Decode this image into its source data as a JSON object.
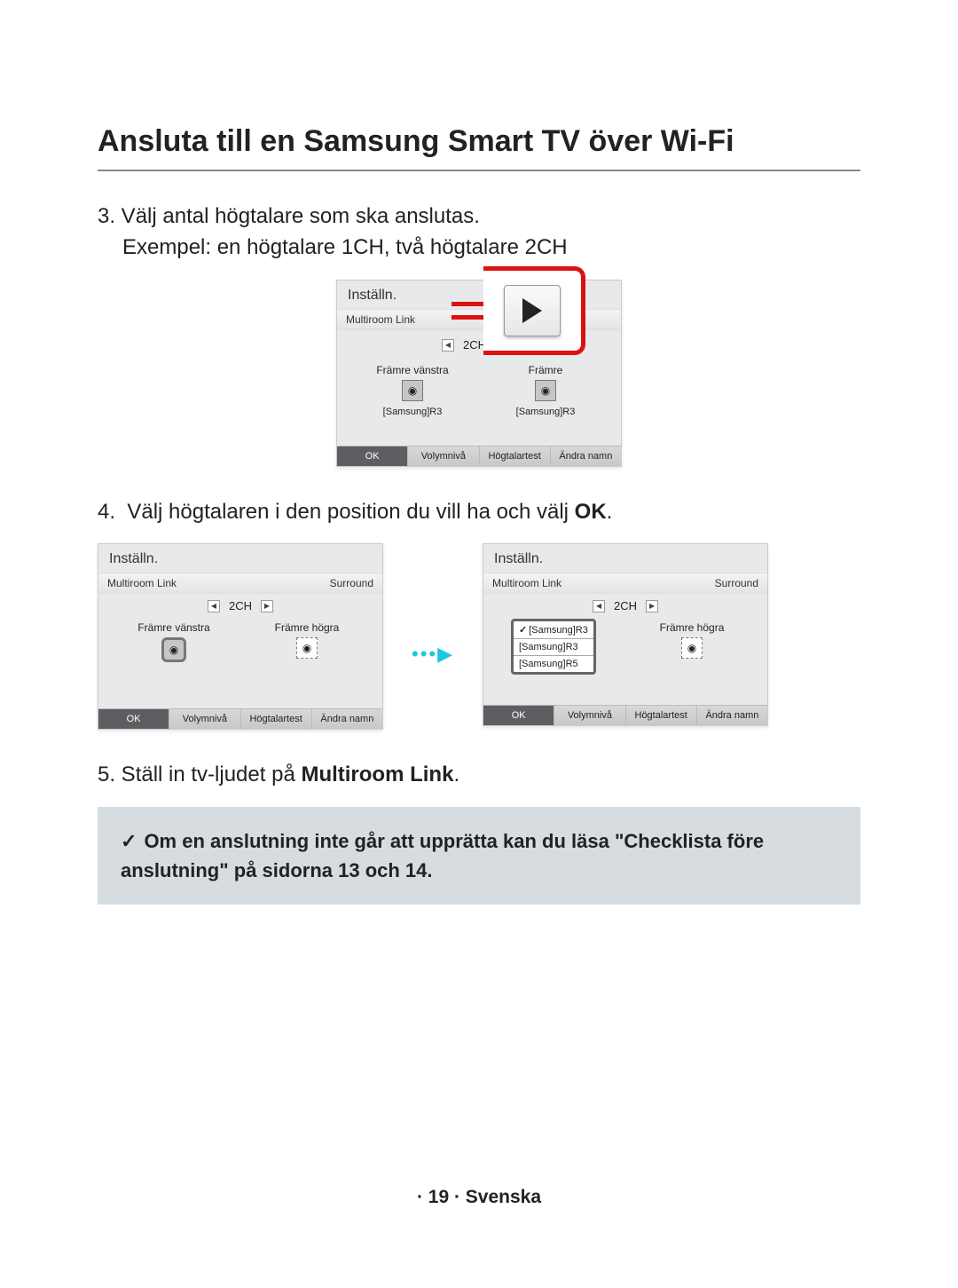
{
  "title": "Ansluta till en Samsung Smart TV över Wi-Fi",
  "step3": {
    "text": "3. Välj antal högtalare som ska anslutas.",
    "example": "Exempel: en högtalare  1CH, två högtalare  2CH"
  },
  "step4": "4.  Välj högtalaren i den position du vill ha och välj OK.",
  "step5_a": "5.  Ställ in tv-ljudet på ",
  "step5_b": "Multiroom Link",
  "step5_c": ".",
  "note": "Om en anslutning inte går att upprätta kan du läsa \"Checklista före anslutning\" på sidorna 13 och 14.",
  "panel_header": "Inställn.",
  "panel_sub_left": "Multiroom Link",
  "panel_sub_right": "Surround",
  "ch": "2CH",
  "left_label": "Främre vänstra",
  "right_label_short": "Främre",
  "right_label": "Främre högra",
  "device": "[Samsung]R3",
  "dropdown": {
    "sel": "[Samsung]R3",
    "o2": "[Samsung]R3",
    "o3": "[Samsung]R5"
  },
  "footer": {
    "ok": "OK",
    "vol": "Volymnivå",
    "test": "Högtalartest",
    "rename": "Ändra namn"
  },
  "pagefoot": "· 19 · Svenska",
  "tick": "✓",
  "ok_bold": "OK"
}
